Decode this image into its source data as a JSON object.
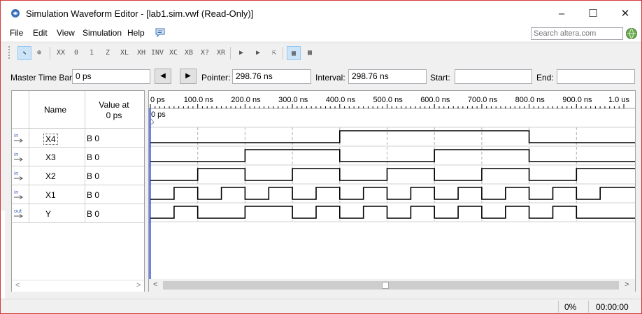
{
  "window": {
    "title": "Simulation Waveform Editor - [lab1.sim.vwf (Read-Only)]",
    "controls": [
      "–",
      "☐",
      "✕"
    ]
  },
  "menu": {
    "items": [
      "File",
      "Edit",
      "View",
      "Simulation",
      "Help"
    ],
    "search_placeholder": "Search altera.com"
  },
  "toolbar": {
    "buttons": [
      {
        "icon": "selection-tool-icon",
        "glyph": "⬉"
      },
      {
        "icon": "zoom-tool-icon",
        "glyph": "⊕"
      },
      {
        "icon": "forcing-unknown-icon",
        "glyph": "XX"
      },
      {
        "icon": "forcing-low-icon",
        "glyph": "0"
      },
      {
        "icon": "forcing-high-icon",
        "glyph": "1"
      },
      {
        "icon": "high-impedance-icon",
        "glyph": "Z"
      },
      {
        "icon": "weak-low-icon",
        "glyph": "XL"
      },
      {
        "icon": "weak-high-icon",
        "glyph": "XH"
      },
      {
        "icon": "invert-icon",
        "glyph": "INV"
      },
      {
        "icon": "count-value-icon",
        "glyph": "XC"
      },
      {
        "icon": "clock-value-icon",
        "glyph": "XB"
      },
      {
        "icon": "arbitrary-value-icon",
        "glyph": "X?"
      },
      {
        "icon": "random-value-icon",
        "glyph": "XR"
      },
      {
        "icon": "run-functional-simulation-icon",
        "glyph": "▶"
      },
      {
        "icon": "run-timing-simulation-icon",
        "glyph": "▶"
      },
      {
        "icon": "generate-netlist-icon",
        "glyph": "⇱"
      },
      {
        "icon": "snap-to-grid-icon",
        "glyph": "▦"
      },
      {
        "icon": "grid-settings-icon",
        "glyph": "▩"
      }
    ]
  },
  "timebar": {
    "master_label": "Master Time Bar:",
    "master_value": "0 ps",
    "prev_glyph": "◀",
    "next_glyph": "▶",
    "pointer_label": "Pointer:",
    "pointer_value": "298.76 ns",
    "interval_label": "Interval:",
    "interval_value": "298.76 ns",
    "start_label": "Start:",
    "start_value": "",
    "end_label": "End:",
    "end_value": ""
  },
  "signals_table": {
    "col_name": "Name",
    "col_value_line1": "Value at",
    "col_value_line2": "0 ps",
    "rows": [
      {
        "type": "in",
        "name": "X4",
        "value": "B 0"
      },
      {
        "type": "in",
        "name": "X3",
        "value": "B 0"
      },
      {
        "type": "in",
        "name": "X2",
        "value": "B 0"
      },
      {
        "type": "in",
        "name": "X1",
        "value": "B 0"
      },
      {
        "type": "out",
        "name": "Y",
        "value": "B 0"
      }
    ]
  },
  "waveform": {
    "ruler_labels": [
      "0 ps",
      "100.0 ns",
      "200.0 ns",
      "300.0 ns",
      "400.0 ns",
      "500.0 ns",
      "600.0 ns",
      "700.0 ns",
      "800.0 ns",
      "900.0 ns",
      "1.0 us"
    ],
    "cursor_label": "0 ps",
    "time_span_ns": 1000,
    "signals": [
      {
        "name": "X4",
        "transitions_ns": [
          400,
          800
        ]
      },
      {
        "name": "X3",
        "transitions_ns": [
          200,
          400,
          600,
          800
        ]
      },
      {
        "name": "X2",
        "transitions_ns": [
          100,
          200,
          300,
          400,
          500,
          600,
          700,
          800,
          900
        ]
      },
      {
        "name": "X1",
        "transitions_ns": [
          50,
          100,
          150,
          200,
          250,
          300,
          350,
          400,
          450,
          500,
          550,
          600,
          650,
          700,
          750,
          800,
          850,
          900,
          950
        ]
      },
      {
        "name": "Y",
        "transitions_ns": [
          50,
          100,
          200,
          300,
          350,
          400,
          450,
          500,
          550,
          600,
          650,
          700,
          750,
          800,
          850,
          900
        ]
      }
    ]
  },
  "status": {
    "progress": "0%",
    "elapsed": "00:00:00"
  },
  "colors": {
    "cursor": "#1e3fd8",
    "window_border": "#d23a3a"
  }
}
